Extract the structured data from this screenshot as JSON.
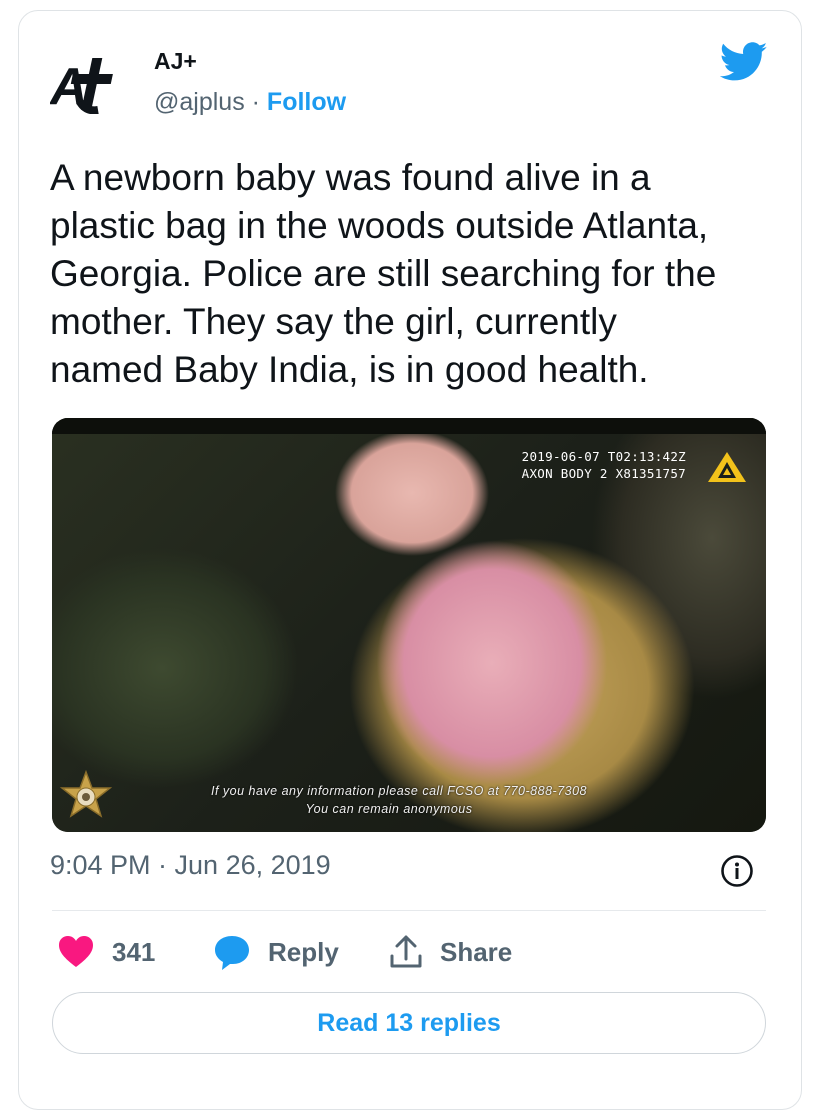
{
  "tweet": {
    "author_name": "AJ+",
    "handle": "@ajplus",
    "separator": " · ",
    "follow_label": "Follow",
    "text": "A newborn baby was found alive in a\nplastic bag in the woods outside Atlanta,\nGeorgia. Police are still searching for the\nmother. They say the girl, currently\nnamed Baby India, is in good health.",
    "timestamp": "9:04 PM · Jun 26, 2019",
    "likes_count": "341",
    "reply_label": "Reply",
    "share_label": "Share",
    "read_replies_label": "Read 13 replies"
  },
  "media": {
    "bodycam_stamp_line1": "2019-06-07 T02:13:42Z",
    "bodycam_stamp_line2": "AXON BODY 2 X81351757",
    "caption_line1": "If you have any information please call FCSO at 770-888-7308",
    "caption_line2": "You can remain anonymous"
  },
  "icons": {
    "brand": "twitter-bird-icon",
    "logo": "aj-plus-logo",
    "like": "heart-icon",
    "reply": "speech-bubble-icon",
    "share": "share-upload-icon",
    "info": "info-icon"
  },
  "colors": {
    "accent": "#1d9bf0",
    "like": "#f91880",
    "text_secondary": "#536471",
    "axon_yellow": "#f2c21b"
  }
}
